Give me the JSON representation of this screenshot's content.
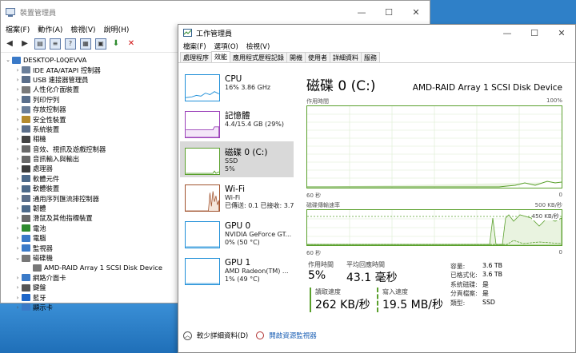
{
  "device_manager": {
    "title": "裝置管理員",
    "menu": [
      "檔案(F)",
      "動作(A)",
      "檢視(V)",
      "說明(H)"
    ],
    "computer": "DESKTOP-L0QEVVA",
    "nodes": [
      {
        "label": "IDE ATA/ATAPI 控制器",
        "color": "#6b7f9a",
        "exp": "›"
      },
      {
        "label": "USB 連接器管理員",
        "color": "#5c6f8a",
        "exp": "›"
      },
      {
        "label": "人性化介面裝置",
        "color": "#7a7a7a",
        "exp": "›"
      },
      {
        "label": "列印佇列",
        "color": "#5a6f8c",
        "exp": "›"
      },
      {
        "label": "存放控制器",
        "color": "#6b7f9a",
        "exp": "›"
      },
      {
        "label": "安全性裝置",
        "color": "#b58b2e",
        "exp": "›"
      },
      {
        "label": "系統裝置",
        "color": "#5c6f8a",
        "exp": "›"
      },
      {
        "label": "相機",
        "color": "#444",
        "exp": "›"
      },
      {
        "label": "音效、視訊及遊戲控制器",
        "color": "#6a6a6a",
        "exp": "›"
      },
      {
        "label": "音訊輸入與輸出",
        "color": "#6a6a6a",
        "exp": "›"
      },
      {
        "label": "處理器",
        "color": "#3d3d3d",
        "exp": "›"
      },
      {
        "label": "軟體元件",
        "color": "#4d6a8a",
        "exp": "›"
      },
      {
        "label": "軟體裝置",
        "color": "#4d6a8a",
        "exp": "›"
      },
      {
        "label": "通用序列匯流排控制器",
        "color": "#5c6f8a",
        "exp": "›"
      },
      {
        "label": "韌體",
        "color": "#4d6a8a",
        "exp": "›"
      },
      {
        "label": "滑鼠及其他指標裝置",
        "color": "#6a6a6a",
        "exp": "›"
      },
      {
        "label": "電池",
        "color": "#2e8b2e",
        "exp": "›"
      },
      {
        "label": "電腦",
        "color": "#3a7ac8",
        "exp": "›"
      },
      {
        "label": "監視器",
        "color": "#3a7ac8",
        "exp": "›"
      },
      {
        "label": "磁碟機",
        "color": "#777",
        "exp": "⌄"
      },
      {
        "label": "AMD-RAID Array 1  SCSI Disk Device",
        "color": "#777",
        "exp": "",
        "indent": true
      },
      {
        "label": "網路介面卡",
        "color": "#3a7ac8",
        "exp": "›"
      },
      {
        "label": "鍵盤",
        "color": "#555",
        "exp": "›"
      },
      {
        "label": "藍牙",
        "color": "#1e66c8",
        "exp": "›"
      },
      {
        "label": "顯示卡",
        "color": "#3a7ac8",
        "exp": "›"
      }
    ]
  },
  "task_manager": {
    "title": "工作管理員",
    "menu": [
      "檔案(F)",
      "選項(O)",
      "檢視(V)"
    ],
    "tabs": [
      "處理程序",
      "效能",
      "應用程式歷程記錄",
      "開機",
      "使用者",
      "詳細資料",
      "服務"
    ],
    "active_tab": 1,
    "resources": [
      {
        "name": "CPU",
        "l1": "16%  3.86 GHz",
        "l2": "",
        "l3": "",
        "color": "#1f8fd8"
      },
      {
        "name": "記憶體",
        "l1": "4.4/15.4 GB (29%)",
        "l2": "",
        "l3": "",
        "color": "#9a3fb8"
      },
      {
        "name": "磁碟 0 (C:)",
        "l1": "SSD",
        "l2": "5%",
        "l3": "",
        "color": "#5aa02c"
      },
      {
        "name": "Wi-Fi",
        "l1": "Wi-Fi",
        "l2": "已傳送: 0.1  已接收: 3.7",
        "l3": "",
        "color": "#a0522d"
      },
      {
        "name": "GPU 0",
        "l1": "NVIDIA GeForce GT...",
        "l2": "0% (50 °C)",
        "l3": "",
        "color": "#1f8fd8"
      },
      {
        "name": "GPU 1",
        "l1": "AMD Radeon(TM) ...",
        "l2": "1% (49 °C)",
        "l3": "",
        "color": "#1f8fd8"
      }
    ],
    "detail": {
      "title": "磁碟 0 (C:)",
      "model": "AMD-RAID Array 1  SCSI Disk Device",
      "g1_label": "作用時間",
      "g1_max": "100%",
      "g1_xleft": "60 秒",
      "g1_xright": "0",
      "g2_label": "磁碟傳輸速率",
      "g2_max": "500 KB/秒",
      "g2_mark": "450 KB/秒",
      "g2_xleft": "60 秒",
      "g2_xright": "0",
      "active_label": "作用時間",
      "active_value": "5%",
      "resp_label": "平均回應時間",
      "resp_value": "43.1 毫秒",
      "read_label": "讀取速度",
      "read_value": "262 KB/秒",
      "write_label": "寫入速度",
      "write_value": "19.5 MB/秒",
      "props": [
        {
          "k": "容量:",
          "v": "3.6 TB"
        },
        {
          "k": "已格式化:",
          "v": "3.6 TB"
        },
        {
          "k": "系統磁碟:",
          "v": "是"
        },
        {
          "k": "分頁檔案:",
          "v": "是"
        },
        {
          "k": "類型:",
          "v": "SSD"
        }
      ]
    },
    "footer": {
      "less": "較少詳細資料(D)",
      "open": "開啟資源監視器"
    }
  }
}
